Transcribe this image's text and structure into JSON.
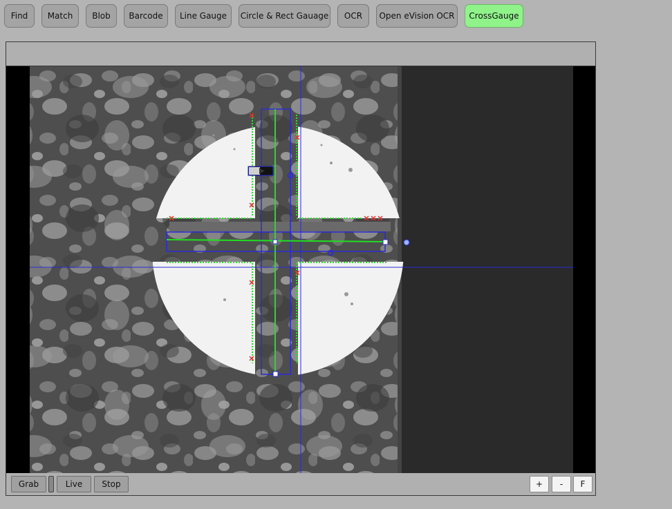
{
  "toolbar": {
    "buttons": [
      {
        "label": "Find",
        "active": false
      },
      {
        "label": "Match",
        "active": false
      },
      {
        "label": "Blob",
        "active": false
      },
      {
        "label": "Barcode",
        "active": false
      },
      {
        "label": "Line Gauge",
        "active": false
      },
      {
        "label": "Circle & Rect Gauage",
        "active": false
      },
      {
        "label": "OCR",
        "active": false
      },
      {
        "label": "Open eVision OCR",
        "active": false
      },
      {
        "label": "CrossGauge",
        "active": true
      }
    ]
  },
  "camera_controls": {
    "grab": "Grab",
    "live": "Live",
    "stop": "Stop"
  },
  "zoom_controls": {
    "zoom_in": "+",
    "zoom_out": "-",
    "fit": "F"
  },
  "colors": {
    "active_tab": "#8ff38a",
    "overlay_roi": "#2b2bd6",
    "overlay_fit_line": "#20e020",
    "edge_ok": "#3ad43a",
    "edge_reject": "#e03030"
  }
}
